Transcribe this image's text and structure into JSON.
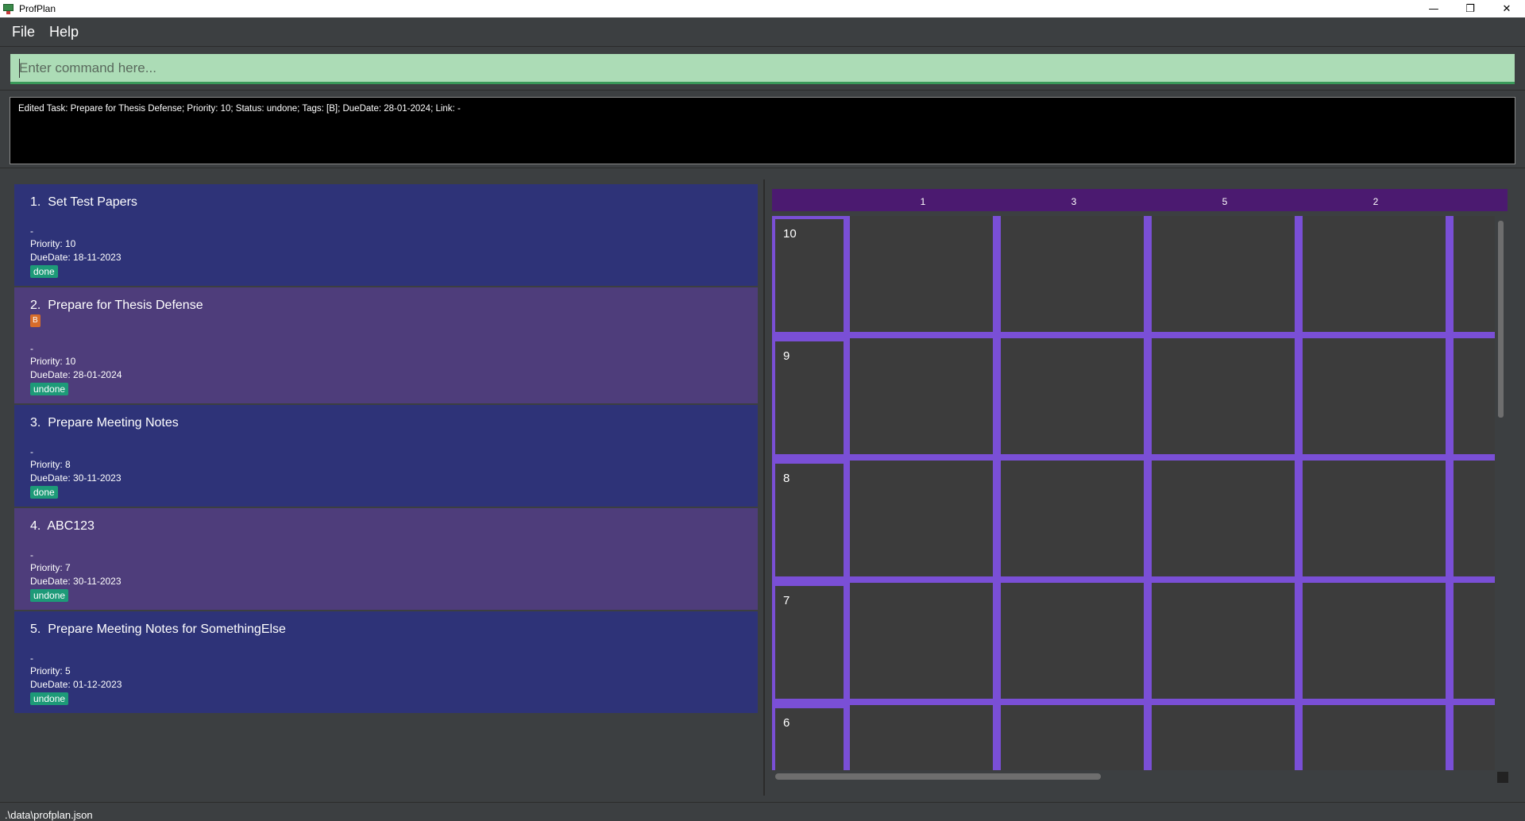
{
  "window": {
    "title": "ProfPlan",
    "minimize_glyph": "—",
    "restore_glyph": "❐",
    "close_glyph": "✕"
  },
  "menu": {
    "file": "File",
    "help": "Help"
  },
  "command": {
    "placeholder": "Enter command here...",
    "value": ""
  },
  "result": {
    "text": "Edited Task: Prepare for Thesis Defense; Priority: 10; Status: undone; Tags: [B]; DueDate: 28-01-2024; Link: -"
  },
  "tasks": [
    {
      "index": "1.",
      "name": "Set Test Papers",
      "tags": [],
      "link": "-",
      "priority": "Priority: 10",
      "due": "DueDate: 18-11-2023",
      "status": "done"
    },
    {
      "index": "2.",
      "name": "Prepare for Thesis Defense",
      "tags": [
        "B"
      ],
      "link": "-",
      "priority": "Priority: 10",
      "due": "DueDate: 28-01-2024",
      "status": "undone"
    },
    {
      "index": "3.",
      "name": "Prepare Meeting Notes",
      "tags": [],
      "link": "-",
      "priority": "Priority: 8",
      "due": "DueDate: 30-11-2023",
      "status": "done"
    },
    {
      "index": "4.",
      "name": "ABC123",
      "tags": [],
      "link": "-",
      "priority": "Priority: 7",
      "due": "DueDate: 30-11-2023",
      "status": "undone"
    },
    {
      "index": "5.",
      "name": "Prepare Meeting Notes for SomethingElse",
      "tags": [],
      "link": "-",
      "priority": "Priority: 5",
      "due": "DueDate: 01-12-2023",
      "status": "undone"
    }
  ],
  "grid": {
    "columns": [
      "1",
      "3",
      "5",
      "2"
    ],
    "rows": [
      "10",
      "9",
      "8",
      "7",
      "6"
    ]
  },
  "status_bar": {
    "path": ".\\data\\profplan.json"
  },
  "colors": {
    "task_odd": "#2e3378",
    "task_even": "#4e3d7b",
    "grid_line": "#7a4fd6",
    "grid_header": "#4b1a70",
    "status_badge": "#1d9a78",
    "tag_badge": "#d76c2a",
    "command_bg": "#acdcb6"
  }
}
